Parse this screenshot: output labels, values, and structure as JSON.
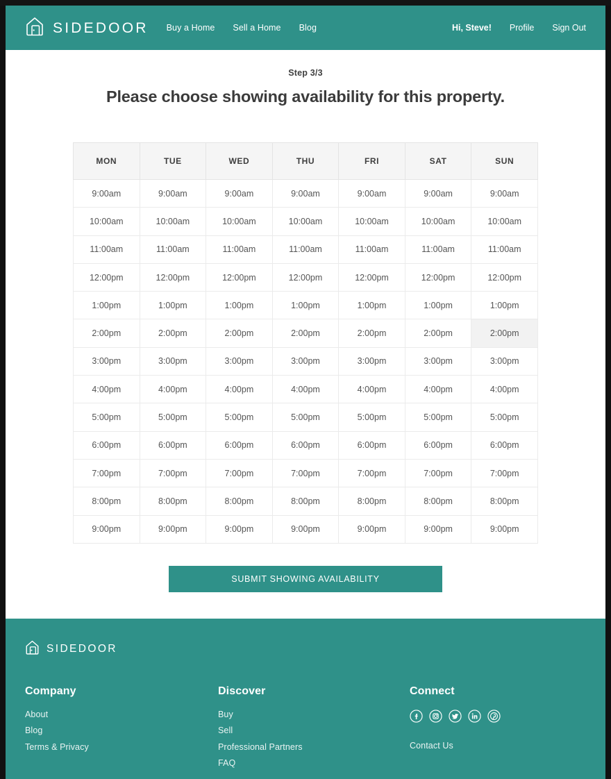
{
  "header": {
    "brand": "SIDEDOOR",
    "brand_icon": "house-logo-icon",
    "nav": [
      {
        "label": "Buy a Home"
      },
      {
        "label": "Sell a Home"
      },
      {
        "label": "Blog"
      }
    ],
    "user_nav": [
      {
        "label": "Hi, Steve!"
      },
      {
        "label": "Profile"
      },
      {
        "label": "Sign Out"
      }
    ]
  },
  "main": {
    "step_label": "Step 3/3",
    "title": "Please choose showing availability for this property.",
    "submit_label": "SUBMIT SHOWING AVAILABILITY"
  },
  "schedule": {
    "days": [
      "MON",
      "TUE",
      "WED",
      "THU",
      "FRI",
      "SAT",
      "SUN"
    ],
    "times": [
      "9:00am",
      "10:00am",
      "11:00am",
      "12:00pm",
      "1:00pm",
      "2:00pm",
      "3:00pm",
      "4:00pm",
      "5:00pm",
      "6:00pm",
      "7:00pm",
      "8:00pm",
      "9:00pm"
    ],
    "hovered_cell": {
      "day": "SUN",
      "time": "2:00pm"
    }
  },
  "footer": {
    "brand": "SIDEDOOR",
    "columns": [
      {
        "heading": "Company",
        "links": [
          {
            "label": "About"
          },
          {
            "label": "Blog"
          },
          {
            "label": "Terms & Privacy"
          }
        ]
      },
      {
        "heading": "Discover",
        "links": [
          {
            "label": "Buy"
          },
          {
            "label": "Sell"
          },
          {
            "label": "Professional Partners"
          },
          {
            "label": "FAQ"
          }
        ]
      },
      {
        "heading": "Connect",
        "social": [
          {
            "name": "facebook-icon"
          },
          {
            "name": "instagram-icon"
          },
          {
            "name": "twitter-icon"
          },
          {
            "name": "linkedin-icon"
          },
          {
            "name": "pinterest-icon"
          }
        ],
        "contact_label": "Contact Us"
      }
    ]
  },
  "colors": {
    "teal": "#2f9189",
    "header_row": "#f5f5f5",
    "hover_cell": "#f2f2f2",
    "text_dark": "#3b3b3b"
  }
}
